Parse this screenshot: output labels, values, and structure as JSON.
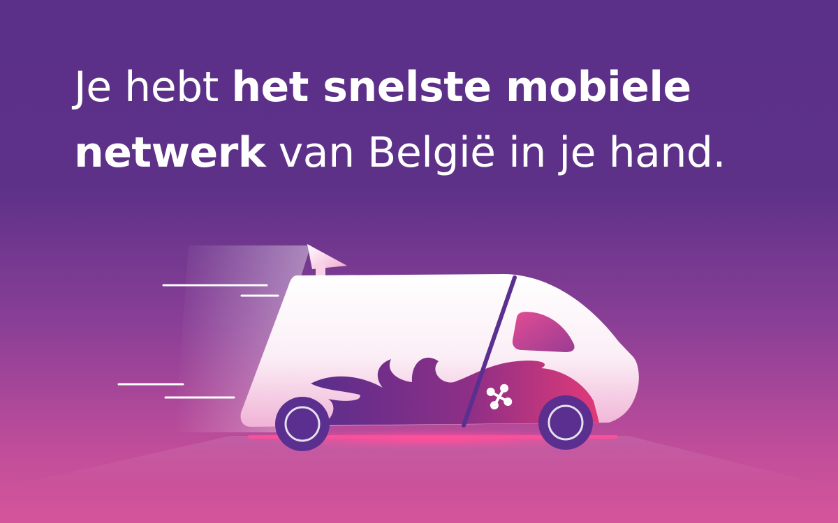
{
  "headline": {
    "line1_regular": "Je hebt ",
    "line1_bold": "het snelste mobiele",
    "line2_bold": "netwerk",
    "line2_regular": " van België in je hand."
  },
  "illustration": {
    "subject": "van-with-flames",
    "logo_icon": "proximus-x-icon"
  },
  "colors": {
    "background_top": "#5a3088",
    "background_bottom": "#d5559b",
    "text": "#ffffff",
    "van_body": "#ffffff",
    "flame_start": "#5a2e8c",
    "flame_end": "#e03a78",
    "wheel": "#5a2f8f",
    "glow": "#ff4f9a"
  }
}
